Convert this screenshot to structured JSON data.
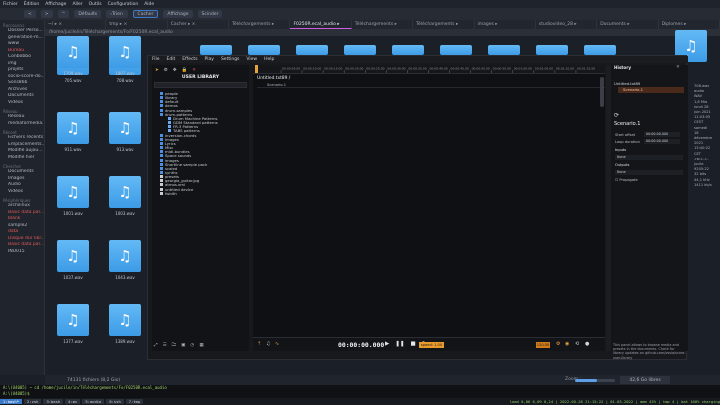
{
  "os": {
    "menubar": [
      "Fichier",
      "Édition",
      "Affichage",
      "Aller",
      "Outils",
      "Configuration",
      "Aide"
    ],
    "toolbar": [
      "<",
      ">",
      "^",
      "Défaults",
      "‹Trier›",
      "Cacher",
      "Affichage",
      "Scinder"
    ],
    "tabs": [
      {
        "label": "~/ ▸ ×"
      },
      {
        "label": "tmp ▸ ×"
      },
      {
        "label": "Cacher ▸ ×"
      },
      {
        "label": "Téléchargements ▸"
      },
      {
        "label": "F0250R.ecal_audio ▸"
      },
      {
        "label": "Téléchargements ▸"
      },
      {
        "label": "Téléchargements ▸"
      },
      {
        "label": "images ▸"
      },
      {
        "label": "studiovideo_28 ▸"
      },
      {
        "label": "Documents ▸"
      },
      {
        "label": "Diplomes ▸"
      }
    ],
    "path": "/home/jucile/in/Téléchargements/Fo/F0250R.ecal_audio",
    "sidebar": [
      {
        "h": "Raccourcis",
        "items": [
          "Dossier Perso...",
          "generation-m...",
          "www",
          "Bureau",
          "Conbobbo",
          "img",
          "projets",
          "socio-score-do...",
          "Sons86b",
          "Archives",
          "Documents",
          "Vidéos"
        ]
      },
      {
        "h": "Réseau",
        "items": [
          "Réseau",
          "mediaformedia..."
        ]
      },
      {
        "h": "Récent",
        "items": [
          "Fichiers récents",
          "Emplacements...",
          "Modifié aujou...",
          "Modifié hier"
        ]
      },
      {
        "h": "Chercher",
        "items": [
          "Documents",
          "Images",
          "Audio",
          "Vidéos"
        ]
      },
      {
        "h": "Périphériques",
        "items": [
          "archilinux",
          "Basic data par...",
          "blank",
          "sample2",
          "data",
          "Disque dur libr...",
          "Basic data par...",
          "INU015"
        ]
      }
    ],
    "files": [
      {
        "name": "705.wav"
      },
      {
        "name": "708.wav"
      },
      {
        "name": "911.wav"
      },
      {
        "name": "913.wav"
      },
      {
        "name": "1001.wav"
      },
      {
        "name": "1003.wav"
      },
      {
        "name": "1037.wav"
      },
      {
        "name": "1043.wav"
      },
      {
        "name": "1377.wav"
      },
      {
        "name": "1389.wav"
      },
      {
        "name": "1709.wav"
      },
      {
        "name": "1807.wav"
      }
    ],
    "info_lines": [
      "708.wav",
      "audio",
      "WAV",
      "1,6 Mio",
      "lundi 28",
      "juin 2021",
      "11:03:05",
      "CEST",
      "samedi",
      "18",
      "décembre",
      "2021",
      "13:40:22",
      "CET",
      "-rw-r--r--",
      "jucile",
      "9205:22",
      "32 bits",
      "44,1 kHz",
      "1411 kb/s"
    ],
    "status": "74131 fichiers (8,2 Gio)",
    "zoom_label": "Zoom :",
    "list_button": "42,6 Go libres",
    "terminal": [
      "A:\\(U4005) ~ cd /home/jucile/in/Téléchargements/Fo/F0250R.ecal_audio",
      "A:\\(U4005)$"
    ],
    "tmux_windows": [
      "1:bash*",
      "2:zsh",
      "3:bash",
      "4:mc",
      "5:audio",
      "6:ssh",
      "7:tmp"
    ],
    "tmux_right": "load 0,06 0,09 0,24 | 2022-05-28 21:15:22 | 01-03-2022 | mem 43% | tmp 4 | bat 100% charging"
  },
  "app": {
    "menu": [
      "File",
      "Edit",
      "Effects",
      "Play",
      "Settings",
      "View",
      "Help"
    ],
    "library": {
      "title": "USER LIBRARY",
      "search_placeholder": "",
      "tree": [
        {
          "t": "people",
          "l": 1
        },
        {
          "t": "library",
          "l": 1
        },
        {
          "t": "default",
          "l": 1
        },
        {
          "t": "demos",
          "l": 1
        },
        {
          "t": "drum-samples",
          "l": 1
        },
        {
          "t": "drum-patterns",
          "l": 1
        },
        {
          "t": "Drum Machine Patterns",
          "l": 2
        },
        {
          "t": "GDM Standard patterns",
          "l": 2
        },
        {
          "t": "FR.3 Patterns",
          "l": 2
        },
        {
          "t": "TABS patterns",
          "l": 2
        },
        {
          "t": "inversion-chords",
          "l": 1
        },
        {
          "t": "Images",
          "l": 1
        },
        {
          "t": "Lyrics",
          "l": 1
        },
        {
          "t": "Misc",
          "l": 1
        },
        {
          "t": "midi-bundles",
          "l": 1
        },
        {
          "t": "Space sounds",
          "l": 1
        },
        {
          "t": "images",
          "l": 1
        },
        {
          "t": "Shortline sample pack",
          "l": 1
        },
        {
          "t": "scaled",
          "l": 1
        },
        {
          "t": "synths",
          "l": 1
        },
        {
          "t": "presets",
          "l": 1,
          "f": true
        },
        {
          "t": "georgia_guitar.jpg",
          "l": 1,
          "f": true
        },
        {
          "t": "atmos.xml",
          "l": 1,
          "f": true
        },
        {
          "t": "untitled device",
          "l": 1,
          "f": true
        },
        {
          "t": "fwidth",
          "l": 1,
          "f": true
        }
      ]
    },
    "editor": {
      "document": "Untitled.txt89 /",
      "scenario_line": "Scenario.1",
      "ruler_ticks": [
        "00:00:05.00",
        "00:00:10.00",
        "00:00:15.00",
        "00:00:20.00",
        "00:00:25.00",
        "00:00:30.00",
        "00:00:35.00",
        "00:00:40.00",
        "00:00:45.00",
        "00:00:50.00",
        "00:00:55.00",
        "00:01:00.00",
        "00:01:05.00",
        "00:01:10.00",
        "00:01:15.00"
      ],
      "timecode": "00:00:00.000",
      "transport": [
        "▶",
        "❚❚",
        "■",
        "⟳"
      ],
      "speed": "speed: 1.00",
      "tempo": "120.00",
      "playhead_fraction": 0.0
    },
    "history": {
      "title": "History",
      "item1": "Untitled.txt89",
      "item2": "Scenario.1",
      "scenario_title": "Scenario.1",
      "props": [
        {
          "label": "Start offset",
          "value": "00:00:00.000"
        },
        {
          "label": "Loop duration",
          "value": "00:00:00.000"
        }
      ],
      "inputs_label": "Inputs",
      "inputs_value": "None",
      "outputs_label": "Outputs",
      "outputs_value": "None",
      "propagate": "Propagate",
      "help": "This panel allows to browse media and presets in the documents. Check for library updates on github.com/ossia/score-user-library"
    }
  }
}
